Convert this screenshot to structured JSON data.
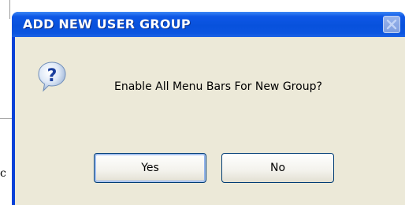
{
  "dialog": {
    "title": "ADD NEW USER GROUP",
    "close_icon": "close-icon",
    "message_icon": "question-icon",
    "message": "Enable All Menu Bars For New Group?",
    "buttons": {
      "yes": "Yes",
      "no": "No"
    }
  },
  "background": {
    "partial_char": "c"
  },
  "colors": {
    "title_bar": "#0851dc",
    "client_area": "#ece9d8",
    "button_border": "#003c74"
  }
}
